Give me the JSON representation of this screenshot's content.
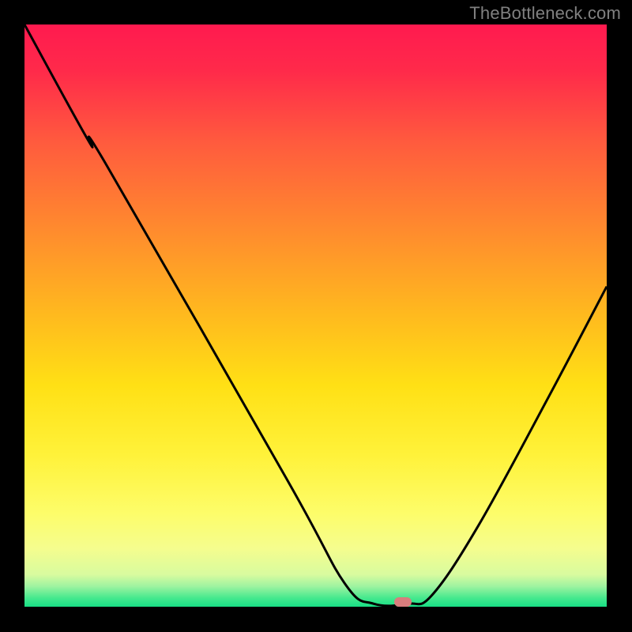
{
  "branding": {
    "text": "TheBottleneck.com"
  },
  "colors": {
    "frame_bg": "#000000",
    "branding_text": "#808080",
    "curve_stroke": "#000000",
    "marker_fill": "#d87d7d",
    "gradient_stops": [
      {
        "offset": 0.0,
        "color": "#ff1a4f"
      },
      {
        "offset": 0.08,
        "color": "#ff2a4a"
      },
      {
        "offset": 0.2,
        "color": "#ff5a3e"
      },
      {
        "offset": 0.35,
        "color": "#ff8a2e"
      },
      {
        "offset": 0.5,
        "color": "#ffba1e"
      },
      {
        "offset": 0.62,
        "color": "#ffe015"
      },
      {
        "offset": 0.74,
        "color": "#fff23a"
      },
      {
        "offset": 0.84,
        "color": "#fdfd6a"
      },
      {
        "offset": 0.9,
        "color": "#f5fd8e"
      },
      {
        "offset": 0.945,
        "color": "#d8fb9f"
      },
      {
        "offset": 0.965,
        "color": "#9ef3a0"
      },
      {
        "offset": 0.985,
        "color": "#45e98e"
      },
      {
        "offset": 1.0,
        "color": "#18df85"
      }
    ]
  },
  "chart_data": {
    "type": "line",
    "title": "",
    "xlabel": "",
    "ylabel": "",
    "x_range": [
      0,
      100
    ],
    "y_range": [
      0,
      100
    ],
    "series": [
      {
        "name": "curve",
        "points": [
          {
            "x": 0,
            "y": 100
          },
          {
            "x": 11,
            "y": 80
          },
          {
            "x": 14,
            "y": 76
          },
          {
            "x": 45,
            "y": 22
          },
          {
            "x": 55,
            "y": 4
          },
          {
            "x": 60,
            "y": 0.5
          },
          {
            "x": 66,
            "y": 0.5
          },
          {
            "x": 70,
            "y": 2
          },
          {
            "x": 78,
            "y": 14
          },
          {
            "x": 90,
            "y": 36
          },
          {
            "x": 100,
            "y": 55
          }
        ]
      }
    ],
    "marker": {
      "x": 65,
      "y": 0.8
    },
    "note": "x and y are percentages of the plot area; y=0 is the bottom (green) and y=100 is the top (red). Values are estimated from axis-free gradient positions."
  }
}
